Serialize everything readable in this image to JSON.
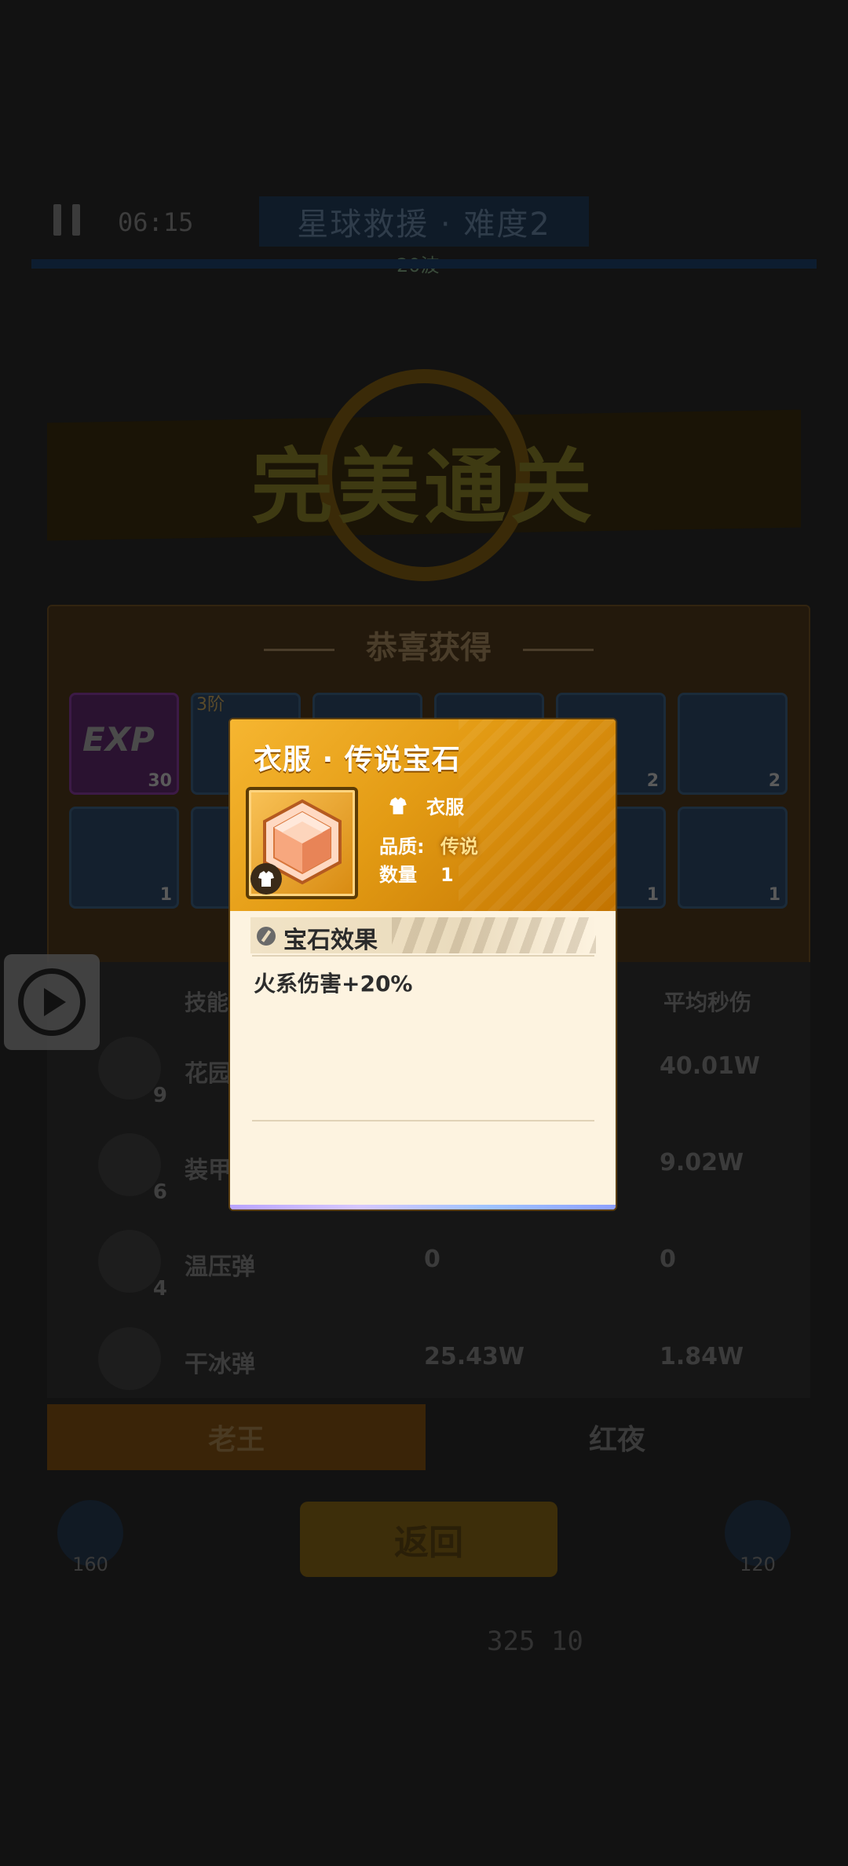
{
  "hud": {
    "timer": "06:15",
    "stage_title": "星球救援 · 难度2",
    "stage_sub": "20波"
  },
  "victory": {
    "text": "完美通关"
  },
  "rewards": {
    "header": "恭喜获得",
    "tiles": [
      {
        "label": "EXP",
        "count": "30",
        "kind": "exp"
      },
      {
        "tier": "3阶",
        "count": "",
        "kind": "gear"
      },
      {
        "count": "",
        "kind": "gear"
      },
      {
        "count": "",
        "kind": "gear"
      },
      {
        "count": "2",
        "kind": "gear"
      },
      {
        "count": "2",
        "kind": "gear"
      },
      {
        "count": "1",
        "kind": "gear"
      },
      {
        "count": "",
        "kind": "gear"
      },
      {
        "count": "",
        "kind": "gear"
      },
      {
        "count": "",
        "kind": "gear"
      },
      {
        "count": "1",
        "kind": "gear"
      },
      {
        "count": "1",
        "kind": "gear"
      }
    ]
  },
  "stats": {
    "col_skill": "技能",
    "col_dps": "平均秒伤",
    "rows": [
      {
        "name": "花园",
        "level": "9",
        "damage": "",
        "dps": "40.01W"
      },
      {
        "name": "装甲",
        "level": "6",
        "damage": "",
        "dps": "9.02W"
      },
      {
        "name": "温压弹",
        "level": "4",
        "damage": "0",
        "dps": "0"
      },
      {
        "name": "干冰弹",
        "level": "",
        "damage": "25.43W",
        "dps": "1.84W"
      }
    ]
  },
  "tabs": {
    "active": "老王",
    "inactive": "红夜"
  },
  "actions": {
    "back": "返回"
  },
  "resources": {
    "left": "160",
    "right": "120"
  },
  "footer": {
    "text": "325 10"
  },
  "popup": {
    "title": "衣服 · 传说宝石",
    "type_label": "衣服",
    "quality_key": "品质:",
    "quality_value": "传说",
    "quantity_key": "数量",
    "quantity_value": "1",
    "effect_title": "宝石效果",
    "effect_text": "火系伤害+20%",
    "colors": {
      "header": "#e39b14",
      "body": "#fdf3e0",
      "quality": "#ffe08a"
    }
  }
}
